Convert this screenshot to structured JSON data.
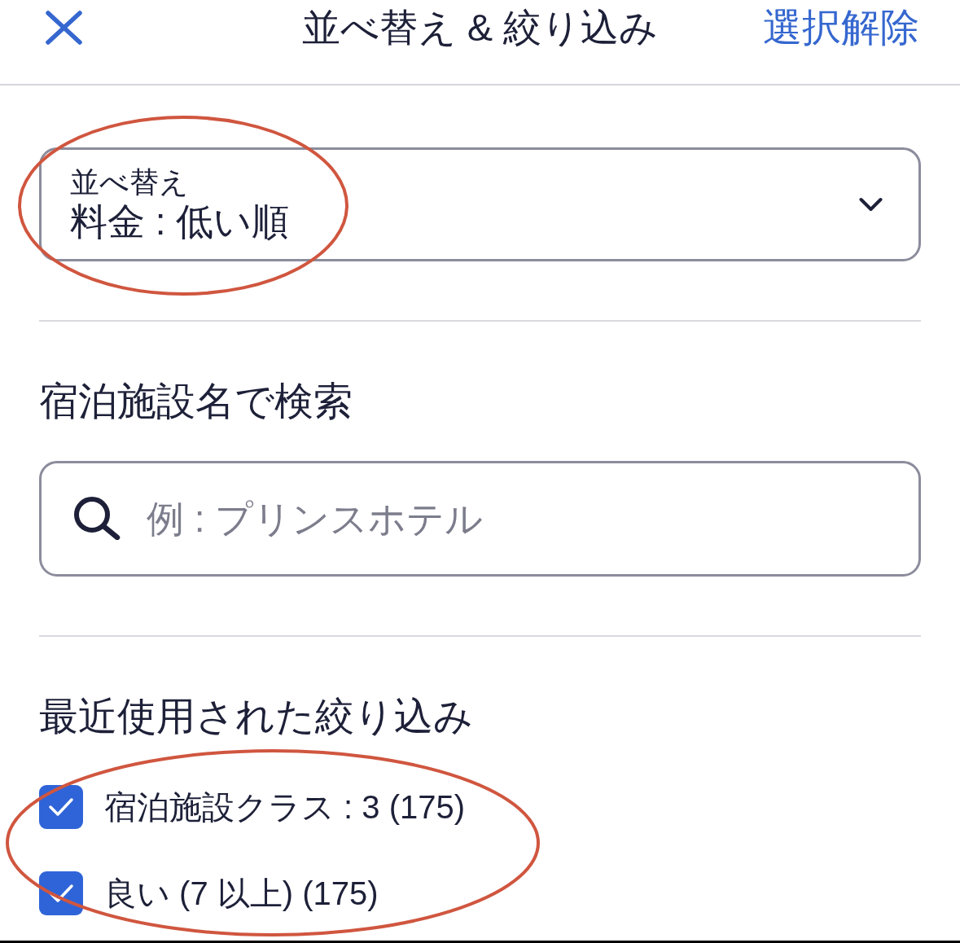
{
  "header": {
    "title": "並べ替え & 絞り込み",
    "action": "選択解除"
  },
  "sort": {
    "label": "並べ替え",
    "value": "料金 : 低い順",
    "circled": true
  },
  "search": {
    "heading": "宿泊施設名で検索",
    "placeholder": "例 : プリンスホテル"
  },
  "recent_filters": {
    "heading": "最近使用された絞り込み",
    "circled": true,
    "items": [
      {
        "label": "宿泊施設クラス : 3 (175)",
        "checked": true
      },
      {
        "label": "良い (7 以上) (175)",
        "checked": true
      }
    ]
  }
}
